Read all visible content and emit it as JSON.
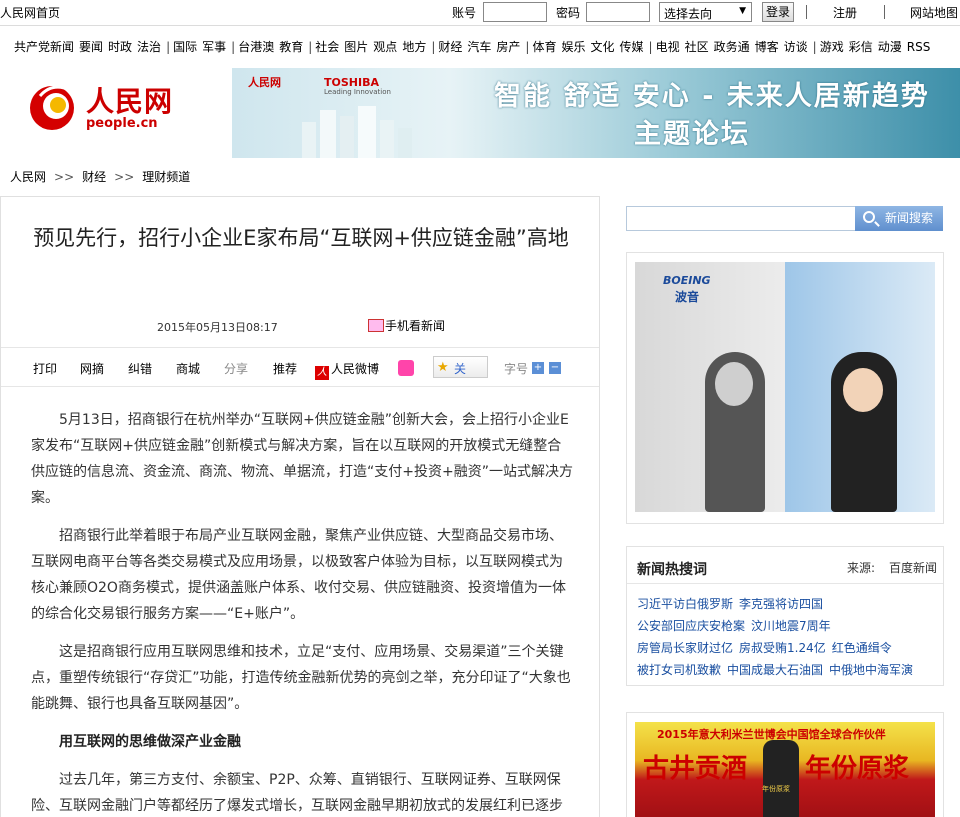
{
  "topbar": {
    "home": "人民网首页",
    "account_label": "账号",
    "password_label": "密码",
    "goto_select": "选择去向",
    "login_button": "登录",
    "register": "注册",
    "sitemap": "网站地图"
  },
  "nav": [
    [
      "共产党新闻",
      "要闻",
      "时政",
      "法治"
    ],
    [
      "国际",
      "军事"
    ],
    [
      "台港澳",
      "教育"
    ],
    [
      "社会",
      "图片",
      "观点",
      "地方"
    ],
    [
      "财经",
      "汽车",
      "房产"
    ],
    [
      "体育",
      "娱乐",
      "文化",
      "传媒"
    ],
    [
      "电视",
      "社区",
      "政务通",
      "博客",
      "访谈"
    ],
    [
      "游戏",
      "彩信",
      "动漫",
      "RSS"
    ]
  ],
  "logo": {
    "name": "人民网",
    "url": "people.cn"
  },
  "banner": {
    "partner1": "人民网",
    "partner2": "TOSHIBA",
    "partner2_tagline": "Leading Innovation",
    "line1": "智能 舒适 安心 - 未来人居新趋势",
    "line2": "主题论坛"
  },
  "breadcrumb": [
    "人民网",
    "财经",
    "理财频道"
  ],
  "breadcrumb_sep": ">>",
  "article": {
    "title": "预见先行，招行小企业E家布局“互联网+供应链金融”高地",
    "date": "2015年05月13日08:17",
    "mobile_news": "手机看新闻",
    "tools": {
      "print": "打印",
      "excerpt": "网摘",
      "correct": "纠错",
      "mall": "商城",
      "share": "分享",
      "recommend": "推荐",
      "weibo": "人民微博",
      "follow": "关",
      "font_size": "字号"
    },
    "paragraphs": [
      "5月13日，招商银行在杭州举办“互联网+供应链金融”创新大会，会上招行小企业E家发布“互联网+供应链金融”创新模式与解决方案，旨在以互联网的开放模式无缝整合供应链的信息流、资金流、商流、物流、单据流，打造“支付+投资+融资”一站式解决方案。",
      "招商银行此举着眼于布局产业互联网金融，聚焦产业供应链、大型商品交易市场、互联网电商平台等各类交易模式及应用场景，以极致客户体验为目标，以互联网模式为核心兼顾O2O商务模式，提供涵盖账户体系、收付交易、供应链融资、投资增值为一体的综合化交易银行服务方案——“E+账户”。",
      "这是招商银行应用互联网思维和技术，立足“支付、应用场景、交易渠道”三个关键点，重塑传统银行“存贷汇”功能，打造传统金融新优势的亮剑之举，充分印证了“大象也能跳舞、银行也具备互联网基因”。",
      "用互联网的思维做深产业金融",
      "过去几年，第三方支付、余额宝、P2P、众筹、直销银行、互联网证券、互联网保险、互联网金融门户等都经历了爆发式增长，互联网金融早期初放式的发展红利已逐步消退，大数据、移动金融、人工智能等正在演进为核心驱动力。与此同时，在“互联网"
    ]
  },
  "sidebar": {
    "search_button": "新闻搜索",
    "ad1_brand": "BOEING",
    "ad1_brand_cn": "波音",
    "hot_title": "新闻热搜词",
    "hot_source_label": "来源:",
    "hot_source": "百度新闻",
    "hot_rows": [
      [
        "习近平访白俄罗斯",
        "李克强将访四国"
      ],
      [
        "公安部回应庆安枪案",
        "汶川地震7周年"
      ],
      [
        "房管局长家财过亿",
        "房叔受贿1.24亿",
        "红色通缉令"
      ],
      [
        "被打女司机致歉",
        "中国成最大石油国",
        "中俄地中海军演"
      ]
    ],
    "ad2_line1": "2015年意大利米兰世博会中国馆全球合作伙伴",
    "ad2_left": "古井贡酒",
    "ad2_right": "年份原浆",
    "ad2_bottle_label": "年份原浆"
  }
}
